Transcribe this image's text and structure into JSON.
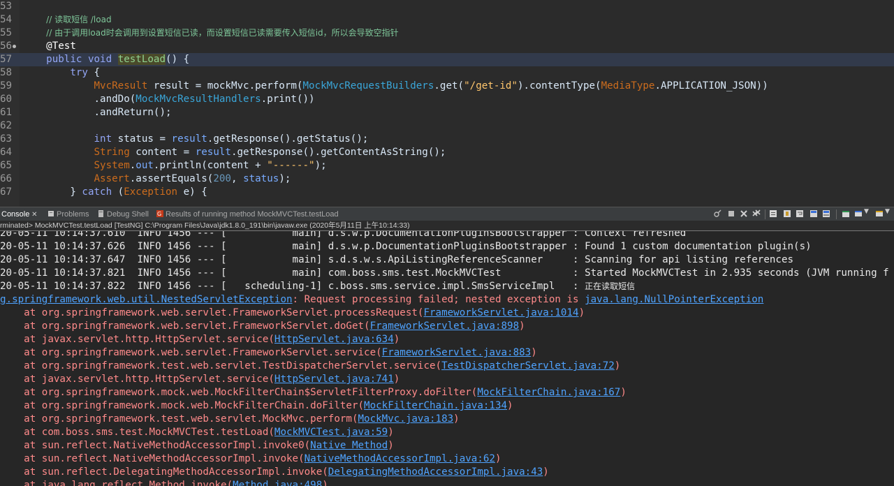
{
  "editor": {
    "lines": [
      {
        "num": "53",
        "parts": []
      },
      {
        "num": "54",
        "parts": [
          {
            "t": "    ",
            "c": "plain"
          },
          {
            "t": "// 读取短信 /load",
            "c": "cm"
          }
        ]
      },
      {
        "num": "55",
        "parts": [
          {
            "t": "    ",
            "c": "plain"
          },
          {
            "t": "// 由于调用load时会调用到设置短信已读，而设置短信已读需要传入短信id，所以会导致空指针",
            "c": "cm"
          }
        ]
      },
      {
        "num": "56",
        "parts": [
          {
            "t": "    ",
            "c": "plain"
          },
          {
            "t": "@Test",
            "c": "ann"
          }
        ]
      },
      {
        "num": "57",
        "parts": [
          {
            "t": "    ",
            "c": "plain"
          },
          {
            "t": "public ",
            "c": "kw2"
          },
          {
            "t": "void ",
            "c": "kw2"
          },
          {
            "t": "testLoad",
            "c": "grn"
          },
          {
            "t": "() {",
            "c": "plain"
          }
        ]
      },
      {
        "num": "58",
        "parts": [
          {
            "t": "        ",
            "c": "plain"
          },
          {
            "t": "try ",
            "c": "kw2"
          },
          {
            "t": "{",
            "c": "plain"
          }
        ]
      },
      {
        "num": "59",
        "parts": [
          {
            "t": "            ",
            "c": "plain"
          },
          {
            "t": "MvcResult ",
            "c": "ty"
          },
          {
            "t": "result = mockMvc.perform(",
            "c": "plain"
          },
          {
            "t": "MockMvcRequestBuilders",
            "c": "cls"
          },
          {
            "t": ".get(",
            "c": "plain"
          },
          {
            "t": "\"/get-id\"",
            "c": "str"
          },
          {
            "t": ").contentType(",
            "c": "plain"
          },
          {
            "t": "MediaType",
            "c": "ty"
          },
          {
            "t": ".APPLICATION_JSON))",
            "c": "plain"
          }
        ]
      },
      {
        "num": "60",
        "parts": [
          {
            "t": "            .andDo(",
            "c": "plain"
          },
          {
            "t": "MockMvcResultHandlers",
            "c": "cls"
          },
          {
            "t": ".print())",
            "c": "plain"
          }
        ]
      },
      {
        "num": "61",
        "parts": [
          {
            "t": "            .andReturn();",
            "c": "plain"
          }
        ]
      },
      {
        "num": "62",
        "parts": []
      },
      {
        "num": "63",
        "parts": [
          {
            "t": "            ",
            "c": "plain"
          },
          {
            "t": "int ",
            "c": "kw2"
          },
          {
            "t": "status = ",
            "c": "plain"
          },
          {
            "t": "result",
            "c": "var"
          },
          {
            "t": ".getResponse().getStatus();",
            "c": "plain"
          }
        ]
      },
      {
        "num": "64",
        "parts": [
          {
            "t": "            ",
            "c": "plain"
          },
          {
            "t": "String ",
            "c": "ty"
          },
          {
            "t": "content = ",
            "c": "plain"
          },
          {
            "t": "result",
            "c": "var"
          },
          {
            "t": ".getResponse().getContentAsString();",
            "c": "plain"
          }
        ]
      },
      {
        "num": "65",
        "parts": [
          {
            "t": "            ",
            "c": "plain"
          },
          {
            "t": "System",
            "c": "ty"
          },
          {
            "t": ".",
            "c": "plain"
          },
          {
            "t": "out",
            "c": "var"
          },
          {
            "t": ".println(content + ",
            "c": "plain"
          },
          {
            "t": "\"------\"",
            "c": "str"
          },
          {
            "t": ");",
            "c": "plain"
          }
        ]
      },
      {
        "num": "66",
        "parts": [
          {
            "t": "            ",
            "c": "plain"
          },
          {
            "t": "Assert",
            "c": "ty"
          },
          {
            "t": ".assertEquals(",
            "c": "plain"
          },
          {
            "t": "200",
            "c": "num"
          },
          {
            "t": ", ",
            "c": "plain"
          },
          {
            "t": "status",
            "c": "var"
          },
          {
            "t": ");",
            "c": "plain"
          }
        ]
      },
      {
        "num": "67",
        "parts": [
          {
            "t": "        } ",
            "c": "plain"
          },
          {
            "t": "catch ",
            "c": "kw2"
          },
          {
            "t": "(",
            "c": "plain"
          },
          {
            "t": "Exception ",
            "c": "ty"
          },
          {
            "t": "e) {",
            "c": "plain"
          }
        ]
      }
    ]
  },
  "tabs": {
    "console": "Console",
    "problems": "Problems",
    "debug_shell": "Debug Shell",
    "results": "Results of running method MockMVCTest.testLoad"
  },
  "launch_info": "rminated> MockMVCTest.testLoad [TestNG] C:\\Program Files\\Java\\jdk1.8.0_191\\bin\\javaw.exe (2020年5月11日 上午10:14:33)",
  "console": {
    "lines": [
      [
        {
          "t": "20-05-11 10:14:37.610  INFO 1456 --- [           main] d.s.w.p.DocumentationPluginsBootstrapper : Context refreshed",
          "c": ""
        }
      ],
      [
        {
          "t": "20-05-11 10:14:37.626  INFO 1456 --- [           main] d.s.w.p.DocumentationPluginsBootstrapper : Found 1 custom documentation plugin(s)",
          "c": ""
        }
      ],
      [
        {
          "t": "20-05-11 10:14:37.647  INFO 1456 --- [           main] s.d.s.w.s.ApiListingReferenceScanner     : Scanning for api listing references",
          "c": ""
        }
      ],
      [
        {
          "t": "20-05-11 10:14:37.821  INFO 1456 --- [           main] com.boss.sms.test.MockMVCTest            : Started MockMVCTest in 2.935 seconds (JVM running f",
          "c": ""
        }
      ],
      [
        {
          "t": "20-05-11 10:14:37.822  INFO 1456 --- [   scheduling-1] c.boss.sms.service.impl.SmsServiceImpl   : ",
          "c": ""
        },
        {
          "t": "正在读取短信",
          "c": "zh"
        }
      ],
      [
        {
          "t": "g.springframework.web.util.NestedServletException",
          "c": "lnk"
        },
        {
          "t": ": Request processing failed; nested exception is ",
          "c": "errm"
        },
        {
          "t": "java.lang.NullPointerException",
          "c": "lnk"
        }
      ],
      [
        {
          "t": "    at org.springframework.web.servlet.FrameworkServlet.processRequest(",
          "c": "errm"
        },
        {
          "t": "FrameworkServlet.java:1014",
          "c": "lnk"
        },
        {
          "t": ")",
          "c": "errm"
        }
      ],
      [
        {
          "t": "    at org.springframework.web.servlet.FrameworkServlet.doGet(",
          "c": "errm"
        },
        {
          "t": "FrameworkServlet.java:898",
          "c": "lnk"
        },
        {
          "t": ")",
          "c": "errm"
        }
      ],
      [
        {
          "t": "    at javax.servlet.http.HttpServlet.service(",
          "c": "errm"
        },
        {
          "t": "HttpServlet.java:634",
          "c": "lnk"
        },
        {
          "t": ")",
          "c": "errm"
        }
      ],
      [
        {
          "t": "    at org.springframework.web.servlet.FrameworkServlet.service(",
          "c": "errm"
        },
        {
          "t": "FrameworkServlet.java:883",
          "c": "lnk"
        },
        {
          "t": ")",
          "c": "errm"
        }
      ],
      [
        {
          "t": "    at org.springframework.test.web.servlet.TestDispatcherServlet.service(",
          "c": "errm"
        },
        {
          "t": "TestDispatcherServlet.java:72",
          "c": "lnk"
        },
        {
          "t": ")",
          "c": "errm"
        }
      ],
      [
        {
          "t": "    at javax.servlet.http.HttpServlet.service(",
          "c": "errm"
        },
        {
          "t": "HttpServlet.java:741",
          "c": "lnk"
        },
        {
          "t": ")",
          "c": "errm"
        }
      ],
      [
        {
          "t": "    at org.springframework.mock.web.MockFilterChain$ServletFilterProxy.doFilter(",
          "c": "errm"
        },
        {
          "t": "MockFilterChain.java:167",
          "c": "lnk"
        },
        {
          "t": ")",
          "c": "errm"
        }
      ],
      [
        {
          "t": "    at org.springframework.mock.web.MockFilterChain.doFilter(",
          "c": "errm"
        },
        {
          "t": "MockFilterChain.java:134",
          "c": "lnk"
        },
        {
          "t": ")",
          "c": "errm"
        }
      ],
      [
        {
          "t": "    at org.springframework.test.web.servlet.MockMvc.perform(",
          "c": "errm"
        },
        {
          "t": "MockMvc.java:183",
          "c": "lnk"
        },
        {
          "t": ")",
          "c": "errm"
        }
      ],
      [
        {
          "t": "    at com.boss.sms.test.MockMVCTest.testLoad(",
          "c": "errm"
        },
        {
          "t": "MockMVCTest.java:59",
          "c": "lnk"
        },
        {
          "t": ")",
          "c": "errm"
        }
      ],
      [
        {
          "t": "    at sun.reflect.NativeMethodAccessorImpl.invoke0(",
          "c": "errm"
        },
        {
          "t": "Native Method",
          "c": "lnk"
        },
        {
          "t": ")",
          "c": "errm"
        }
      ],
      [
        {
          "t": "    at sun.reflect.NativeMethodAccessorImpl.invoke(",
          "c": "errm"
        },
        {
          "t": "NativeMethodAccessorImpl.java:62",
          "c": "lnk"
        },
        {
          "t": ")",
          "c": "errm"
        }
      ],
      [
        {
          "t": "    at sun.reflect.DelegatingMethodAccessorImpl.invoke(",
          "c": "errm"
        },
        {
          "t": "DelegatingMethodAccessorImpl.java:43",
          "c": "lnk"
        },
        {
          "t": ")",
          "c": "errm"
        }
      ],
      [
        {
          "t": "    at java.lang.reflect.Method.invoke(",
          "c": "errm"
        },
        {
          "t": "Method.java:498",
          "c": "lnk"
        },
        {
          "t": ")",
          "c": "errm"
        }
      ]
    ]
  }
}
